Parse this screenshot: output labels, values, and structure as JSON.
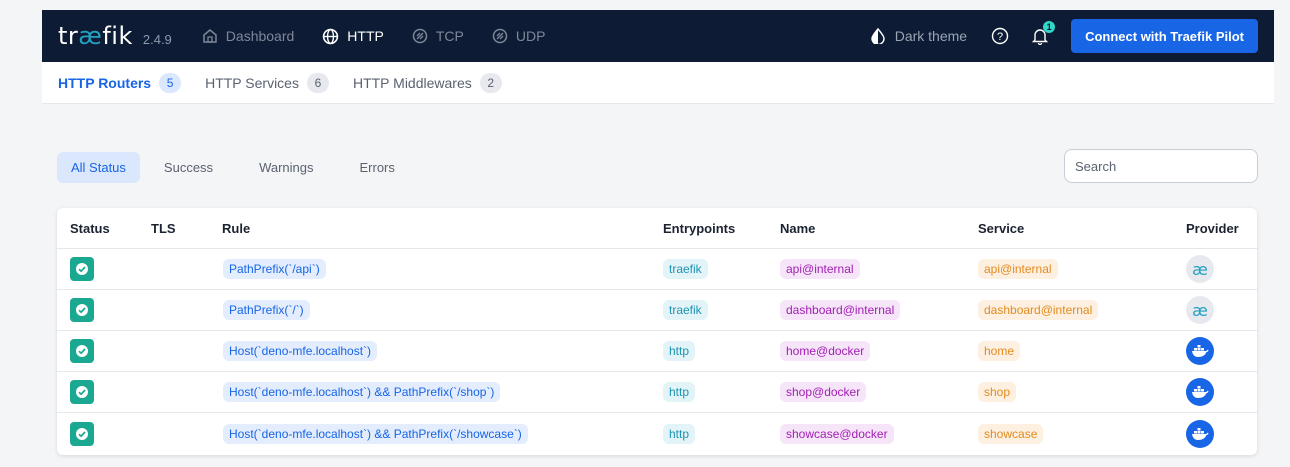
{
  "nav": {
    "logo_prefix": "tr",
    "logo_ae": "æ",
    "logo_suffix": "fik",
    "version": "2.4.9",
    "items": [
      {
        "label": "Dashboard",
        "icon": "home-icon",
        "active": false
      },
      {
        "label": "HTTP",
        "icon": "globe-icon",
        "active": true
      },
      {
        "label": "TCP",
        "icon": "tcp-icon",
        "active": false
      },
      {
        "label": "UDP",
        "icon": "udp-icon",
        "active": false
      }
    ],
    "theme_label": "Dark theme",
    "notification_count": "1",
    "pilot_button": "Connect with Traefik Pilot"
  },
  "subtabs": [
    {
      "label": "HTTP Routers",
      "count": "5",
      "active": true
    },
    {
      "label": "HTTP Services",
      "count": "6",
      "active": false
    },
    {
      "label": "HTTP Middlewares",
      "count": "2",
      "active": false
    }
  ],
  "filters": [
    "All Status",
    "Success",
    "Warnings",
    "Errors"
  ],
  "search": {
    "placeholder": "Search"
  },
  "table": {
    "headers": {
      "status": "Status",
      "tls": "TLS",
      "rule": "Rule",
      "entrypoints": "Entrypoints",
      "name": "Name",
      "service": "Service",
      "provider": "Provider"
    },
    "rows": [
      {
        "status": "success",
        "tls": "",
        "rule": "PathPrefix(`/api`)",
        "entrypoint": "traefik",
        "name": "api@internal",
        "service": "api@internal",
        "provider": "internal"
      },
      {
        "status": "success",
        "tls": "",
        "rule": "PathPrefix(`/`)",
        "entrypoint": "traefik",
        "name": "dashboard@internal",
        "service": "dashboard@internal",
        "provider": "internal"
      },
      {
        "status": "success",
        "tls": "",
        "rule": "Host(`deno-mfe.localhost`)",
        "entrypoint": "http",
        "name": "home@docker",
        "service": "home",
        "provider": "docker"
      },
      {
        "status": "success",
        "tls": "",
        "rule": "Host(`deno-mfe.localhost`) && PathPrefix(`/shop`)",
        "entrypoint": "http",
        "name": "shop@docker",
        "service": "shop",
        "provider": "docker"
      },
      {
        "status": "success",
        "tls": "",
        "rule": "Host(`deno-mfe.localhost`) && PathPrefix(`/showcase`)",
        "entrypoint": "http",
        "name": "showcase@docker",
        "service": "showcase",
        "provider": "docker"
      }
    ]
  },
  "colors": {
    "nav_bg": "#0d1c34",
    "accent": "#1865e6",
    "success": "#1ba890",
    "internal_provider_glyph": "æ"
  }
}
